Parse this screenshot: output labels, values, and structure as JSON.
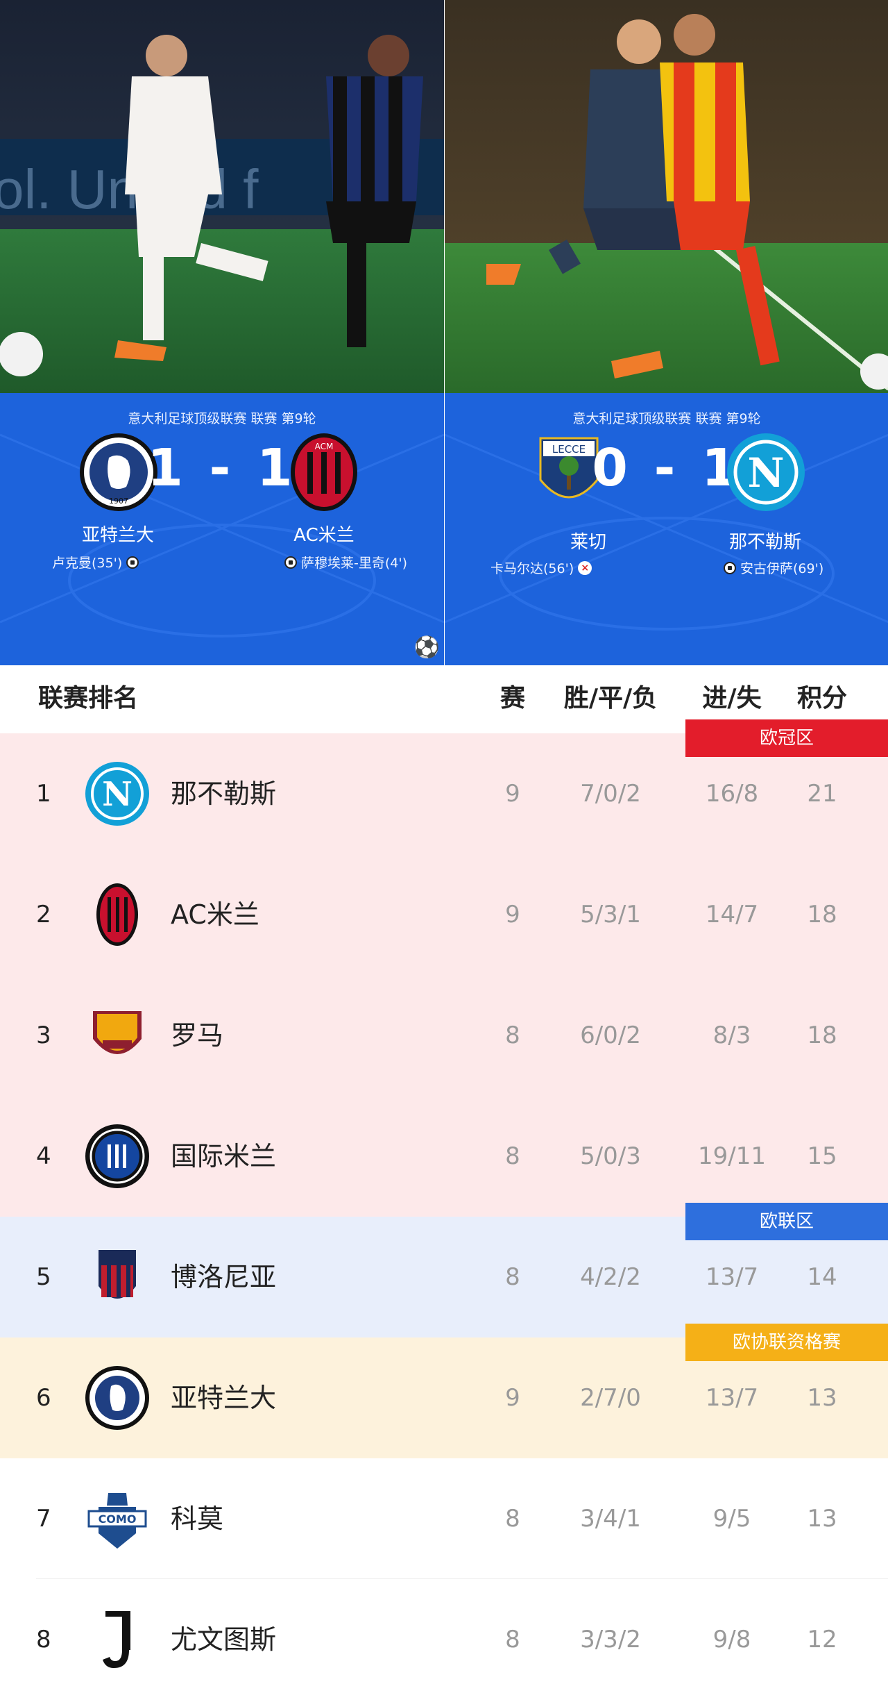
{
  "matches": [
    {
      "league": "意大利足球顶级联赛 联赛 第9轮",
      "home": {
        "name": "亚特兰大",
        "crest": "atalanta-crest"
      },
      "away": {
        "name": "AC米兰",
        "crest": "acmilan-crest"
      },
      "score": "1 - 1",
      "home_scorer": "卢克曼(35')",
      "away_scorer": "萨穆埃莱-里奇(4')"
    },
    {
      "league": "意大利足球顶级联赛 联赛 第9轮",
      "home": {
        "name": "莱切",
        "crest": "lecce-crest"
      },
      "away": {
        "name": "那不勒斯",
        "crest": "napoli-crest"
      },
      "score": "0 - 1",
      "home_scorer": "卡马尔达(56')",
      "away_scorer": "安古伊萨(69')"
    }
  ],
  "standings": {
    "title": "联赛排名",
    "columns": {
      "played": "赛",
      "wdl": "胜/平/负",
      "goals": "进/失",
      "points": "积分"
    },
    "zones": {
      "ucl": "欧冠区",
      "uel": "欧联区",
      "uecl": "欧协联资格赛"
    },
    "colors": {
      "ucl_bg": "#fde9ea",
      "ucl_label": "#e31d2b",
      "uel_bg": "#e8eefb",
      "uel_label": "#2e6fdd",
      "uecl_bg": "#fdf2dc",
      "uecl_label": "#f5b017"
    },
    "rows": [
      {
        "rank": "1",
        "team": "那不勒斯",
        "crest": "napoli-crest",
        "played": "9",
        "wdl": "7/0/2",
        "goals": "16/8",
        "points": "21"
      },
      {
        "rank": "2",
        "team": "AC米兰",
        "crest": "acmilan-crest",
        "played": "9",
        "wdl": "5/3/1",
        "goals": "14/7",
        "points": "18"
      },
      {
        "rank": "3",
        "team": "罗马",
        "crest": "roma-crest",
        "played": "8",
        "wdl": "6/0/2",
        "goals": "8/3",
        "points": "18"
      },
      {
        "rank": "4",
        "team": "国际米兰",
        "crest": "inter-crest",
        "played": "8",
        "wdl": "5/0/3",
        "goals": "19/11",
        "points": "15"
      },
      {
        "rank": "5",
        "team": "博洛尼亚",
        "crest": "bologna-crest",
        "played": "8",
        "wdl": "4/2/2",
        "goals": "13/7",
        "points": "14"
      },
      {
        "rank": "6",
        "team": "亚特兰大",
        "crest": "atalanta-crest",
        "played": "9",
        "wdl": "2/7/0",
        "goals": "13/7",
        "points": "13"
      },
      {
        "rank": "7",
        "team": "科莫",
        "crest": "como-crest",
        "played": "8",
        "wdl": "3/4/1",
        "goals": "9/5",
        "points": "13"
      },
      {
        "rank": "8",
        "team": "尤文图斯",
        "crest": "juventus-crest",
        "played": "8",
        "wdl": "3/3/2",
        "goals": "9/8",
        "points": "12"
      }
    ]
  }
}
